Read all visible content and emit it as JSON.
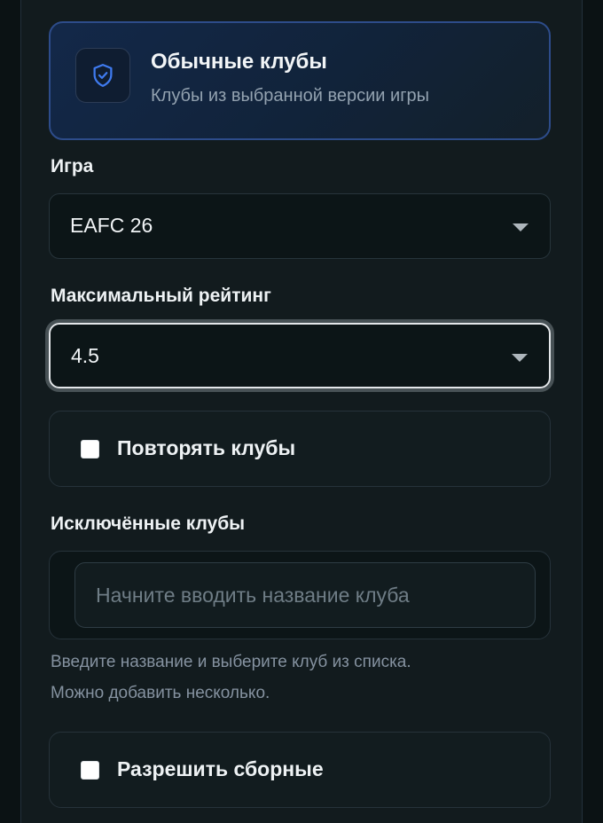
{
  "mode_card": {
    "title": "Обычные клубы",
    "subtitle": "Клубы из выбранной версии игры",
    "icon": "shield-check-icon"
  },
  "game": {
    "label": "Игра",
    "value": "EAFC 26"
  },
  "max_rating": {
    "label": "Максимальный рейтинг",
    "value": "4.5"
  },
  "repeat_clubs": {
    "label": "Повторять клубы",
    "checked": false
  },
  "excluded": {
    "label": "Исключённые клубы",
    "placeholder": "Начните вводить название клуба",
    "value": "",
    "hint_line1": "Введите название и выберите клуб из списка.",
    "hint_line2": "Можно добавить несколько."
  },
  "allow_national": {
    "label": "Разрешить сборные",
    "checked": false
  },
  "colors": {
    "accent_border": "#2d4c8a",
    "icon_blue": "#3f7bf0",
    "background": "#121b1e"
  }
}
